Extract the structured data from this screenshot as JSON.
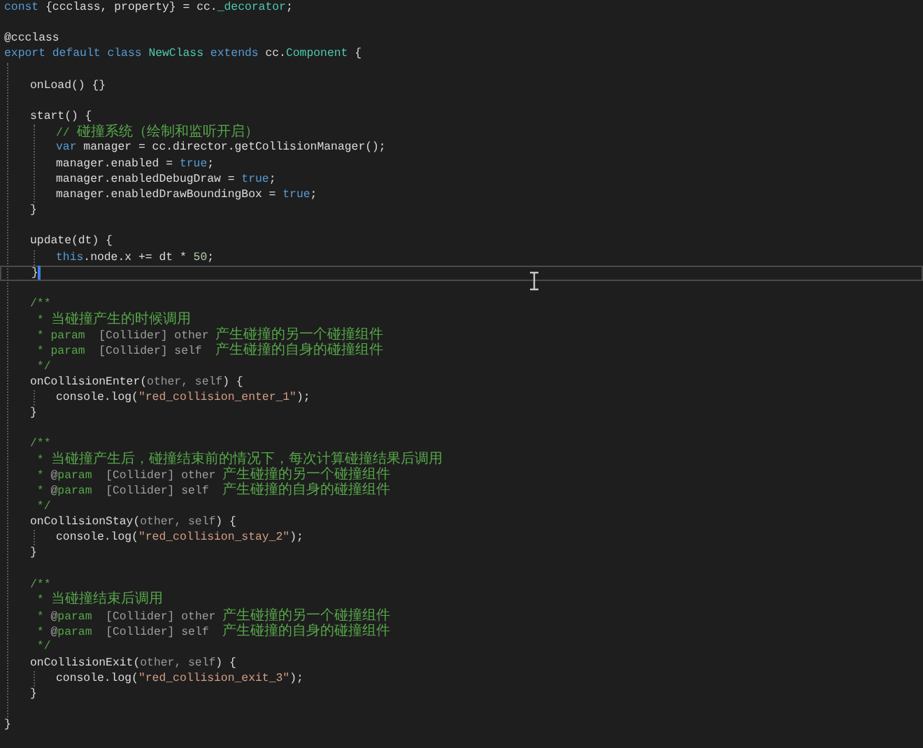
{
  "editor": {
    "lines": [
      {
        "kind": "code",
        "current": false,
        "tokens": [
          {
            "text": "const",
            "kind": "keyword"
          },
          {
            "text": " {ccclass, property} = cc.",
            "kind": "plain"
          },
          {
            "text": "_decorator",
            "kind": "type"
          },
          {
            "text": ";",
            "kind": "plain"
          }
        ]
      },
      {
        "kind": "blank",
        "current": false
      },
      {
        "kind": "code",
        "current": false,
        "tokens": [
          {
            "text": "@ccclass",
            "kind": "plain"
          }
        ]
      },
      {
        "kind": "code",
        "current": false,
        "tokens": [
          {
            "text": "export default class ",
            "kind": "keyword"
          },
          {
            "text": "NewClass",
            "kind": "type"
          },
          {
            "text": " extends",
            "kind": "keyword"
          },
          {
            "text": " cc.",
            "kind": "plain"
          },
          {
            "text": "Component",
            "kind": "type"
          },
          {
            "text": " {",
            "kind": "plain"
          }
        ],
        "children": [
          {
            "kind": "blank",
            "current": false
          },
          {
            "kind": "code",
            "current": false,
            "tokens": [
              {
                "text": "onLoad() {}",
                "kind": "plain"
              }
            ]
          },
          {
            "kind": "blank",
            "current": false
          },
          {
            "kind": "code",
            "current": false,
            "tokens": [
              {
                "text": "start() {",
                "kind": "plain"
              }
            ],
            "children": [
              {
                "kind": "code",
                "current": false,
                "tokens": [
                  {
                    "text": "// 碰撞系统（绘制和监听开启）",
                    "kind": "comment"
                  }
                ]
              },
              {
                "kind": "code",
                "current": false,
                "tokens": [
                  {
                    "text": "var",
                    "kind": "keyword"
                  },
                  {
                    "text": " manager = cc.director.getCollisionManager();",
                    "kind": "plain"
                  }
                ]
              },
              {
                "kind": "code",
                "current": false,
                "tokens": [
                  {
                    "text": "manager.enabled = ",
                    "kind": "plain"
                  },
                  {
                    "text": "true",
                    "kind": "keyword"
                  },
                  {
                    "text": ";",
                    "kind": "plain"
                  }
                ]
              },
              {
                "kind": "code",
                "current": false,
                "tokens": [
                  {
                    "text": "manager.enabledDebugDraw = ",
                    "kind": "plain"
                  },
                  {
                    "text": "true",
                    "kind": "keyword"
                  },
                  {
                    "text": ";",
                    "kind": "plain"
                  }
                ]
              },
              {
                "kind": "code",
                "current": false,
                "tokens": [
                  {
                    "text": "manager.enabledDrawBoundingBox = ",
                    "kind": "plain"
                  },
                  {
                    "text": "true",
                    "kind": "keyword"
                  },
                  {
                    "text": ";",
                    "kind": "plain"
                  }
                ]
              }
            ]
          },
          {
            "kind": "code",
            "current": false,
            "tokens": [
              {
                "text": "}",
                "kind": "plain"
              }
            ]
          },
          {
            "kind": "blank",
            "current": false
          },
          {
            "kind": "code",
            "current": false,
            "tokens": [
              {
                "text": "update(dt) {",
                "kind": "plain"
              }
            ],
            "children": [
              {
                "kind": "code",
                "current": false,
                "tokens": [
                  {
                    "text": "this",
                    "kind": "keyword"
                  },
                  {
                    "text": ".node.x += dt * ",
                    "kind": "plain"
                  },
                  {
                    "text": "50",
                    "kind": "number"
                  },
                  {
                    "text": ";",
                    "kind": "plain"
                  }
                ]
              }
            ]
          },
          {
            "kind": "code",
            "current": true,
            "tokens": [
              {
                "text": "}",
                "kind": "plain"
              }
            ]
          },
          {
            "kind": "blank",
            "current": false
          },
          {
            "kind": "code",
            "current": false,
            "tokens": [
              {
                "text": "/**",
                "kind": "comment"
              }
            ]
          },
          {
            "kind": "code",
            "current": false,
            "tokens": [
              {
                "text": " * 当碰撞产生的时候调用",
                "kind": "comment"
              }
            ]
          },
          {
            "kind": "code",
            "current": false,
            "tokens": [
              {
                "text": " * param",
                "kind": "comment"
              },
              {
                "text": "  [Collider] other",
                "kind": "doc"
              },
              {
                "text": " 产生碰撞的另一个碰撞组件",
                "kind": "comment"
              }
            ]
          },
          {
            "kind": "code",
            "current": false,
            "tokens": [
              {
                "text": " * param",
                "kind": "comment"
              },
              {
                "text": "  [Collider] self",
                "kind": "doc"
              },
              {
                "text": "  产生碰撞的自身的碰撞组件",
                "kind": "comment"
              }
            ]
          },
          {
            "kind": "code",
            "current": false,
            "tokens": [
              {
                "text": " */",
                "kind": "comment"
              }
            ]
          },
          {
            "kind": "code",
            "current": false,
            "tokens": [
              {
                "text": "onCollisionEnter(",
                "kind": "plain"
              },
              {
                "text": "other, self",
                "kind": "param"
              },
              {
                "text": ") {",
                "kind": "plain"
              }
            ],
            "children": [
              {
                "kind": "code",
                "current": false,
                "tokens": [
                  {
                    "text": "console.log(",
                    "kind": "plain"
                  },
                  {
                    "text": "\"red_collision_enter_1\"",
                    "kind": "string"
                  },
                  {
                    "text": ");",
                    "kind": "plain"
                  }
                ]
              }
            ]
          },
          {
            "kind": "code",
            "current": false,
            "tokens": [
              {
                "text": "}",
                "kind": "plain"
              }
            ]
          },
          {
            "kind": "blank",
            "current": false
          },
          {
            "kind": "code",
            "current": false,
            "tokens": [
              {
                "text": "/**",
                "kind": "comment"
              }
            ]
          },
          {
            "kind": "code",
            "current": false,
            "tokens": [
              {
                "text": " * 当碰撞产生后，碰撞结束前的情况下，每次计算碰撞结果后调用",
                "kind": "comment"
              }
            ]
          },
          {
            "kind": "code",
            "current": false,
            "tokens": [
              {
                "text": " * ",
                "kind": "comment"
              },
              {
                "text": "@",
                "kind": "doc"
              },
              {
                "text": "param",
                "kind": "comment"
              },
              {
                "text": "  [Collider] other",
                "kind": "doc"
              },
              {
                "text": " 产生碰撞的另一个碰撞组件",
                "kind": "comment"
              }
            ]
          },
          {
            "kind": "code",
            "current": false,
            "tokens": [
              {
                "text": " * ",
                "kind": "comment"
              },
              {
                "text": "@",
                "kind": "doc"
              },
              {
                "text": "param",
                "kind": "comment"
              },
              {
                "text": "  [Collider] self",
                "kind": "doc"
              },
              {
                "text": "  产生碰撞的自身的碰撞组件",
                "kind": "comment"
              }
            ]
          },
          {
            "kind": "code",
            "current": false,
            "tokens": [
              {
                "text": " */",
                "kind": "comment"
              }
            ]
          },
          {
            "kind": "code",
            "current": false,
            "tokens": [
              {
                "text": "onCollisionStay(",
                "kind": "plain"
              },
              {
                "text": "other, self",
                "kind": "param"
              },
              {
                "text": ") {",
                "kind": "plain"
              }
            ],
            "children": [
              {
                "kind": "code",
                "current": false,
                "tokens": [
                  {
                    "text": "console.log(",
                    "kind": "plain"
                  },
                  {
                    "text": "\"red_collision_stay_2\"",
                    "kind": "string"
                  },
                  {
                    "text": ");",
                    "kind": "plain"
                  }
                ]
              }
            ]
          },
          {
            "kind": "code",
            "current": false,
            "tokens": [
              {
                "text": "}",
                "kind": "plain"
              }
            ]
          },
          {
            "kind": "blank",
            "current": false
          },
          {
            "kind": "code",
            "current": false,
            "tokens": [
              {
                "text": "/**",
                "kind": "comment"
              }
            ]
          },
          {
            "kind": "code",
            "current": false,
            "tokens": [
              {
                "text": " * 当碰撞结束后调用",
                "kind": "comment"
              }
            ]
          },
          {
            "kind": "code",
            "current": false,
            "tokens": [
              {
                "text": " * ",
                "kind": "comment"
              },
              {
                "text": "@",
                "kind": "doc"
              },
              {
                "text": "param",
                "kind": "comment"
              },
              {
                "text": "  [Collider] other",
                "kind": "doc"
              },
              {
                "text": " 产生碰撞的另一个碰撞组件",
                "kind": "comment"
              }
            ]
          },
          {
            "kind": "code",
            "current": false,
            "tokens": [
              {
                "text": " * ",
                "kind": "comment"
              },
              {
                "text": "@",
                "kind": "doc"
              },
              {
                "text": "param",
                "kind": "comment"
              },
              {
                "text": "  [Collider] self",
                "kind": "doc"
              },
              {
                "text": "  产生碰撞的自身的碰撞组件",
                "kind": "comment"
              }
            ]
          },
          {
            "kind": "code",
            "current": false,
            "tokens": [
              {
                "text": " */",
                "kind": "comment"
              }
            ]
          },
          {
            "kind": "code",
            "current": false,
            "tokens": [
              {
                "text": "onCollisionExit(",
                "kind": "plain"
              },
              {
                "text": "other, self",
                "kind": "param"
              },
              {
                "text": ") {",
                "kind": "plain"
              }
            ],
            "children": [
              {
                "kind": "code",
                "current": false,
                "tokens": [
                  {
                    "text": "console.log(",
                    "kind": "plain"
                  },
                  {
                    "text": "\"red_collision_exit_3\"",
                    "kind": "string"
                  },
                  {
                    "text": ");",
                    "kind": "plain"
                  }
                ]
              }
            ]
          },
          {
            "kind": "code",
            "current": false,
            "tokens": [
              {
                "text": "}",
                "kind": "plain"
              }
            ]
          },
          {
            "kind": "blank",
            "current": false
          }
        ]
      },
      {
        "kind": "code",
        "current": false,
        "tokens": [
          {
            "text": "}",
            "kind": "plain"
          }
        ]
      }
    ]
  }
}
